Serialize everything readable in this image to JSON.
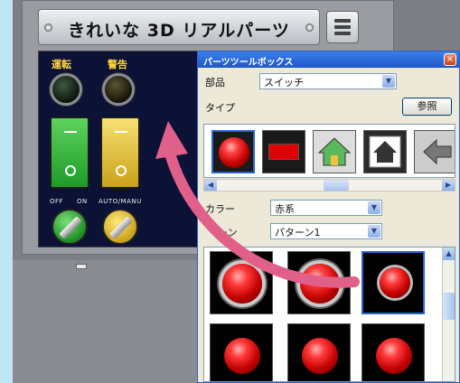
{
  "panel": {
    "title": "きれいな 3D リアルパーツ",
    "lamp_labels": [
      "運転",
      "警告"
    ],
    "selector_labels": [
      "OFF",
      "ON",
      "AUTO/MANU"
    ]
  },
  "toolbox": {
    "title": "パーツツールボックス",
    "close_glyph": "×",
    "part_label": "部品",
    "part_value": "スイッチ",
    "type_label": "タイプ",
    "ref_button": "参照",
    "color_label": "カラー",
    "color_value": "赤系",
    "pattern_label": "ーン",
    "pattern_value": "パターン1"
  },
  "icons": {
    "dropdown": "▼",
    "left": "◀",
    "right": "▶",
    "up": "▲",
    "down": "▼"
  },
  "colors": {
    "arrow": "#e0608a",
    "panel_bg": "#0c1236",
    "toolbox_title": "#2b5fc1",
    "green_switch": "#2fb33a",
    "yellow_switch": "#e5c12e",
    "red_button": "#e00000"
  }
}
